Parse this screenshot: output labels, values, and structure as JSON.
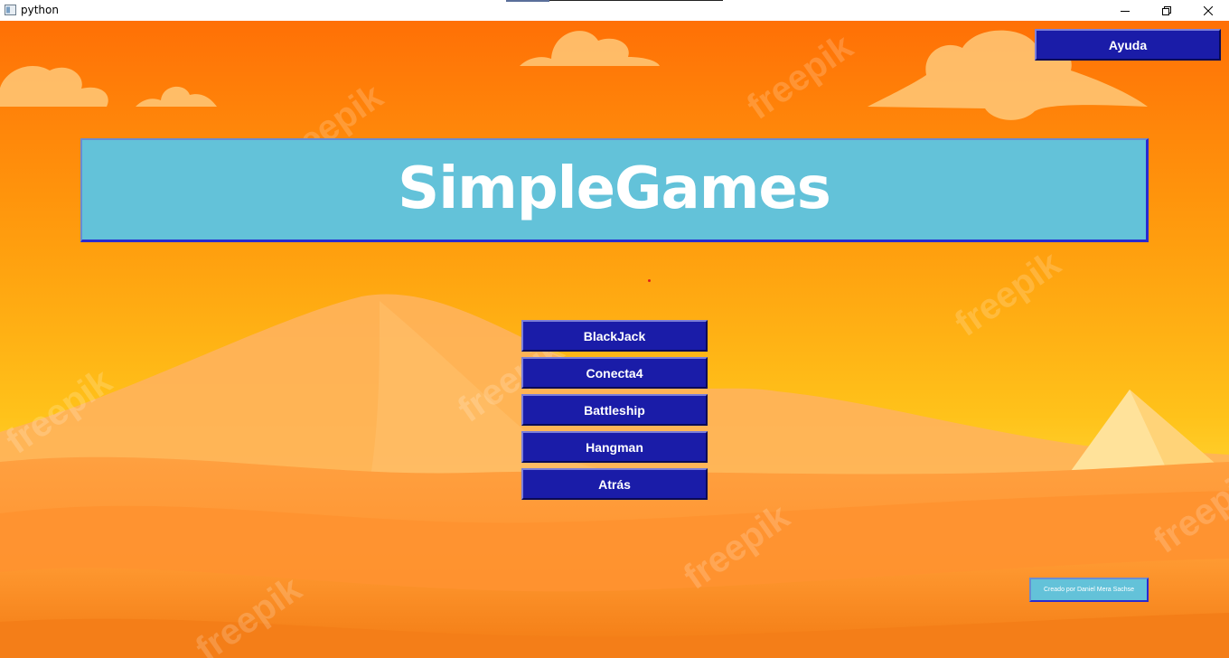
{
  "window": {
    "title": "python",
    "controls": [
      "minimize-icon",
      "restore-icon",
      "close-icon"
    ]
  },
  "header": {
    "help_label": "Ayuda"
  },
  "banner": {
    "title": "SimpleGames"
  },
  "menu": {
    "items": [
      {
        "label": "BlackJack"
      },
      {
        "label": "Conecta4"
      },
      {
        "label": "Battleship"
      },
      {
        "label": "Hangman"
      },
      {
        "label": "Atrás"
      }
    ]
  },
  "footer": {
    "credit": "Creado por Daniel Mera Sachse"
  },
  "background": {
    "watermark": "freepik"
  },
  "colors": {
    "button_bg": "#1a1ca8",
    "banner_bg": "#63c2d9",
    "sky_top": "#ff7a0a",
    "sky_bottom": "#ffd23a"
  }
}
